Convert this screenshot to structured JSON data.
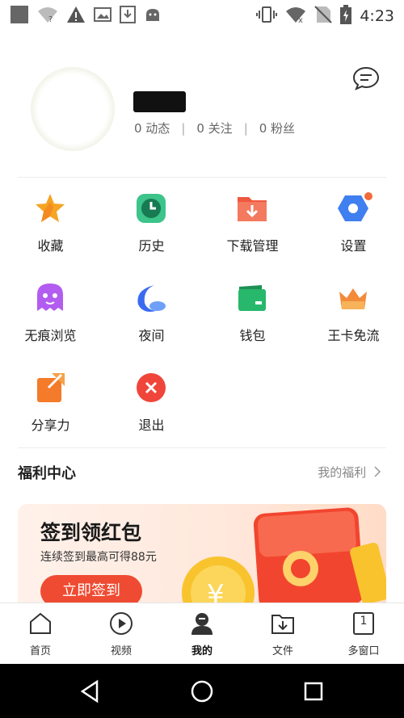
{
  "status_bar": {
    "time": "4:23",
    "left_icons": [
      "notification-square-icon",
      "wifi-question-icon",
      "warning-icon",
      "image-icon",
      "download-icon",
      "android-icon"
    ],
    "right_icons": [
      "vibrate-icon",
      "wifi-icon",
      "no-sim-icon",
      "battery-charging-icon"
    ]
  },
  "profile": {
    "stats": [
      {
        "label": "0 动态"
      },
      {
        "label": "0 关注"
      },
      {
        "label": "0 粉丝"
      }
    ],
    "stats_separator": "|"
  },
  "grid": [
    {
      "label": "收藏",
      "icon": "star-icon",
      "color": "#f6a423"
    },
    {
      "label": "历史",
      "icon": "clock-icon",
      "color": "#3cc48a"
    },
    {
      "label": "下载管理",
      "icon": "download-folder-icon",
      "color": "#f0573f"
    },
    {
      "label": "设置",
      "icon": "settings-hexagon-icon",
      "color": "#3f7ff0",
      "badge_color": "#f26b3a"
    },
    {
      "label": "无痕浏览",
      "icon": "ghost-icon",
      "color": "#b35cf0"
    },
    {
      "label": "夜间",
      "icon": "moon-icon",
      "color": "#3a6cf0"
    },
    {
      "label": "钱包",
      "icon": "wallet-icon",
      "color": "#27b86b"
    },
    {
      "label": "王卡免流",
      "icon": "crown-icon",
      "color": "#f38a3a"
    },
    {
      "label": "分享力",
      "icon": "share-icon",
      "color": "#f37b2a"
    },
    {
      "label": "退出",
      "icon": "exit-icon",
      "color": "#f0453a"
    }
  ],
  "welfare": {
    "title": "福利中心",
    "link": "我的福利"
  },
  "banner": {
    "title": "签到领红包",
    "subtitle": "连续签到最高可得88元",
    "button": "立即签到",
    "accent": "#ef4b32"
  },
  "tabbar": [
    {
      "label": "首页",
      "icon": "home-icon"
    },
    {
      "label": "视频",
      "icon": "play-icon"
    },
    {
      "label": "我的",
      "icon": "user-icon",
      "active": true
    },
    {
      "label": "文件",
      "icon": "folder-icon"
    },
    {
      "label": "多窗口",
      "icon": "window-count-icon",
      "count": "1"
    }
  ]
}
